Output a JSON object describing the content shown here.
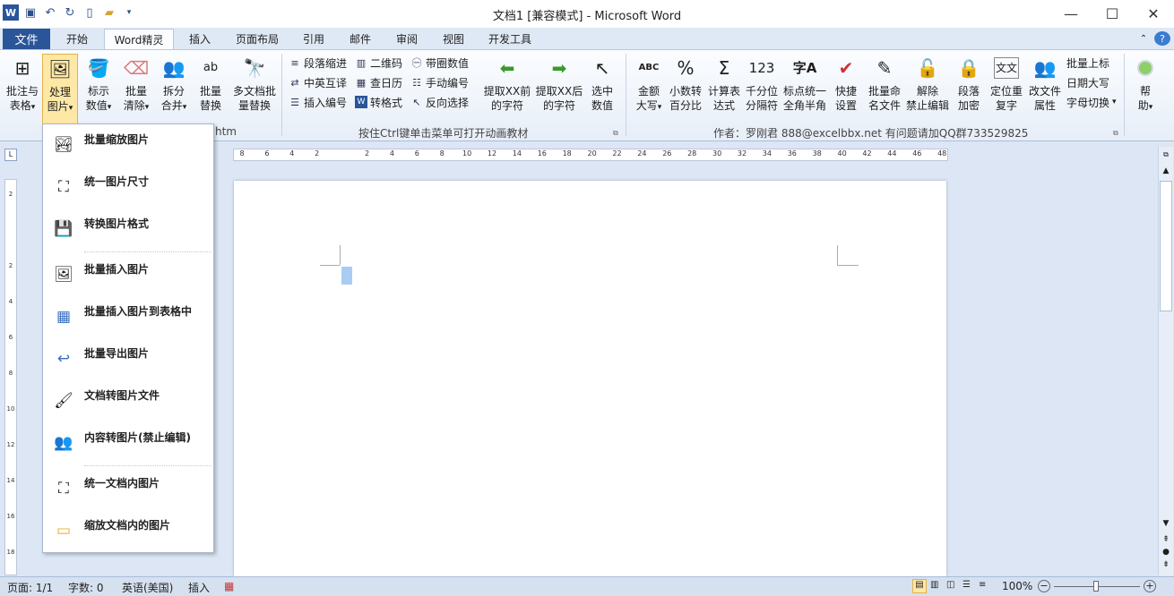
{
  "window": {
    "title": "文档1 [兼容模式] - Microsoft Word"
  },
  "tabs": {
    "file": "文件",
    "items": [
      "开始",
      "Word精灵",
      "插入",
      "页面布局",
      "引用",
      "邮件",
      "审阅",
      "视图",
      "开发工具"
    ],
    "active": "Word精灵"
  },
  "ribbon": {
    "big_buttons": [
      {
        "l1": "批注与",
        "l2": "表格",
        "dd": "▾",
        "icon": "⊞"
      },
      {
        "l1": "处理",
        "l2": "图片",
        "dd": "▾",
        "icon": "🖼"
      },
      {
        "l1": "标示",
        "l2": "数值",
        "dd": "▾",
        "icon": "🪣"
      },
      {
        "l1": "批量",
        "l2": "清除",
        "dd": "▾",
        "icon": "⌫"
      },
      {
        "l1": "拆分",
        "l2": "合并",
        "dd": "▾",
        "icon": "👥"
      },
      {
        "l1": "批量",
        "l2": "替换",
        "dd": "",
        "icon": "ab"
      },
      {
        "l1": "多文档批",
        "l2": "量替换",
        "dd": "",
        "icon": "🔭"
      }
    ],
    "group1_label": "htm",
    "mid_col1": [
      "段落缩进",
      "中英互译",
      "插入编号"
    ],
    "mid_col2": [
      "二维码",
      "查日历",
      "转格式"
    ],
    "mid_col3": [
      "带圈数值",
      "手动编号",
      "反向选择"
    ],
    "mid_buttons": [
      {
        "l1": "提取XX前",
        "l2": "的字符"
      },
      {
        "l1": "提取XX后",
        "l2": "的字符"
      },
      {
        "l1": "选中",
        "l2": "数值"
      }
    ],
    "group2_label": "按住Ctrl键单击菜单可打开动画教材",
    "right_buttons": [
      {
        "l1": "金额",
        "l2": "大写",
        "dd": "▾",
        "icon": "ABC"
      },
      {
        "l1": "小数转",
        "l2": "百分比",
        "dd": "",
        "icon": "%"
      },
      {
        "l1": "计算表",
        "l2": "达式",
        "dd": "",
        "icon": "Σ"
      },
      {
        "l1": "千分位",
        "l2": "分隔符",
        "dd": "",
        "icon": "123"
      },
      {
        "l1": "标点统一",
        "l2": "全角半角",
        "dd": "",
        "icon": "字A"
      },
      {
        "l1": "快捷",
        "l2": "设置",
        "dd": "",
        "icon": "✔"
      },
      {
        "l1": "批量命",
        "l2": "名文件",
        "dd": "",
        "icon": "✎"
      },
      {
        "l1": "解除",
        "l2": "禁止编辑",
        "dd": "",
        "icon": "🔓"
      },
      {
        "l1": "段落",
        "l2": "加密",
        "dd": "",
        "icon": "🔒"
      },
      {
        "l1": "定位重",
        "l2": "复字",
        "dd": "",
        "icon": "文文"
      },
      {
        "l1": "改文件",
        "l2": "属性",
        "dd": "",
        "icon": "👥"
      }
    ],
    "right_small": [
      "批量上标",
      "日期大写",
      "字母切换"
    ],
    "help": {
      "l1": "帮",
      "l2": "助"
    },
    "group3_label": "作者：罗刚君 888@excelbbx.net 有问题请加QQ群733529825"
  },
  "ruler": {
    "h_ticks": [
      "8",
      "6",
      "4",
      "2",
      "",
      "2",
      "4",
      "6",
      "8",
      "10",
      "12",
      "14",
      "16",
      "18",
      "20",
      "22",
      "24",
      "26",
      "28",
      "30",
      "32",
      "34",
      "36",
      "38",
      "40",
      "42",
      "44",
      "46",
      "48"
    ],
    "v_ticks": [
      "2",
      "",
      "2",
      "4",
      "6",
      "8",
      "10",
      "12",
      "14",
      "16",
      "18"
    ]
  },
  "menu": {
    "items": [
      {
        "label": "批量缩放图片",
        "icon": "🏞"
      },
      {
        "label": "统一图片尺寸",
        "icon": "⛶"
      },
      {
        "label": "转换图片格式",
        "icon": "💾"
      },
      {
        "label": "批量插入图片",
        "icon": "🖼"
      },
      {
        "label": "批量插入图片到表格中",
        "icon": "▦"
      },
      {
        "label": "批量导出图片",
        "icon": "↩"
      },
      {
        "label": "文档转图片文件",
        "icon": "🖌"
      },
      {
        "label": "内容转图片(禁止编辑)",
        "icon": "👥"
      },
      {
        "label": "统一文档内图片",
        "icon": "⛶"
      },
      {
        "label": "缩放文档内的图片",
        "icon": "▭"
      }
    ]
  },
  "status": {
    "page": "页面: 1/1",
    "words": "字数: 0",
    "lang": "英语(美国)",
    "mode": "插入",
    "zoom": "100%"
  }
}
